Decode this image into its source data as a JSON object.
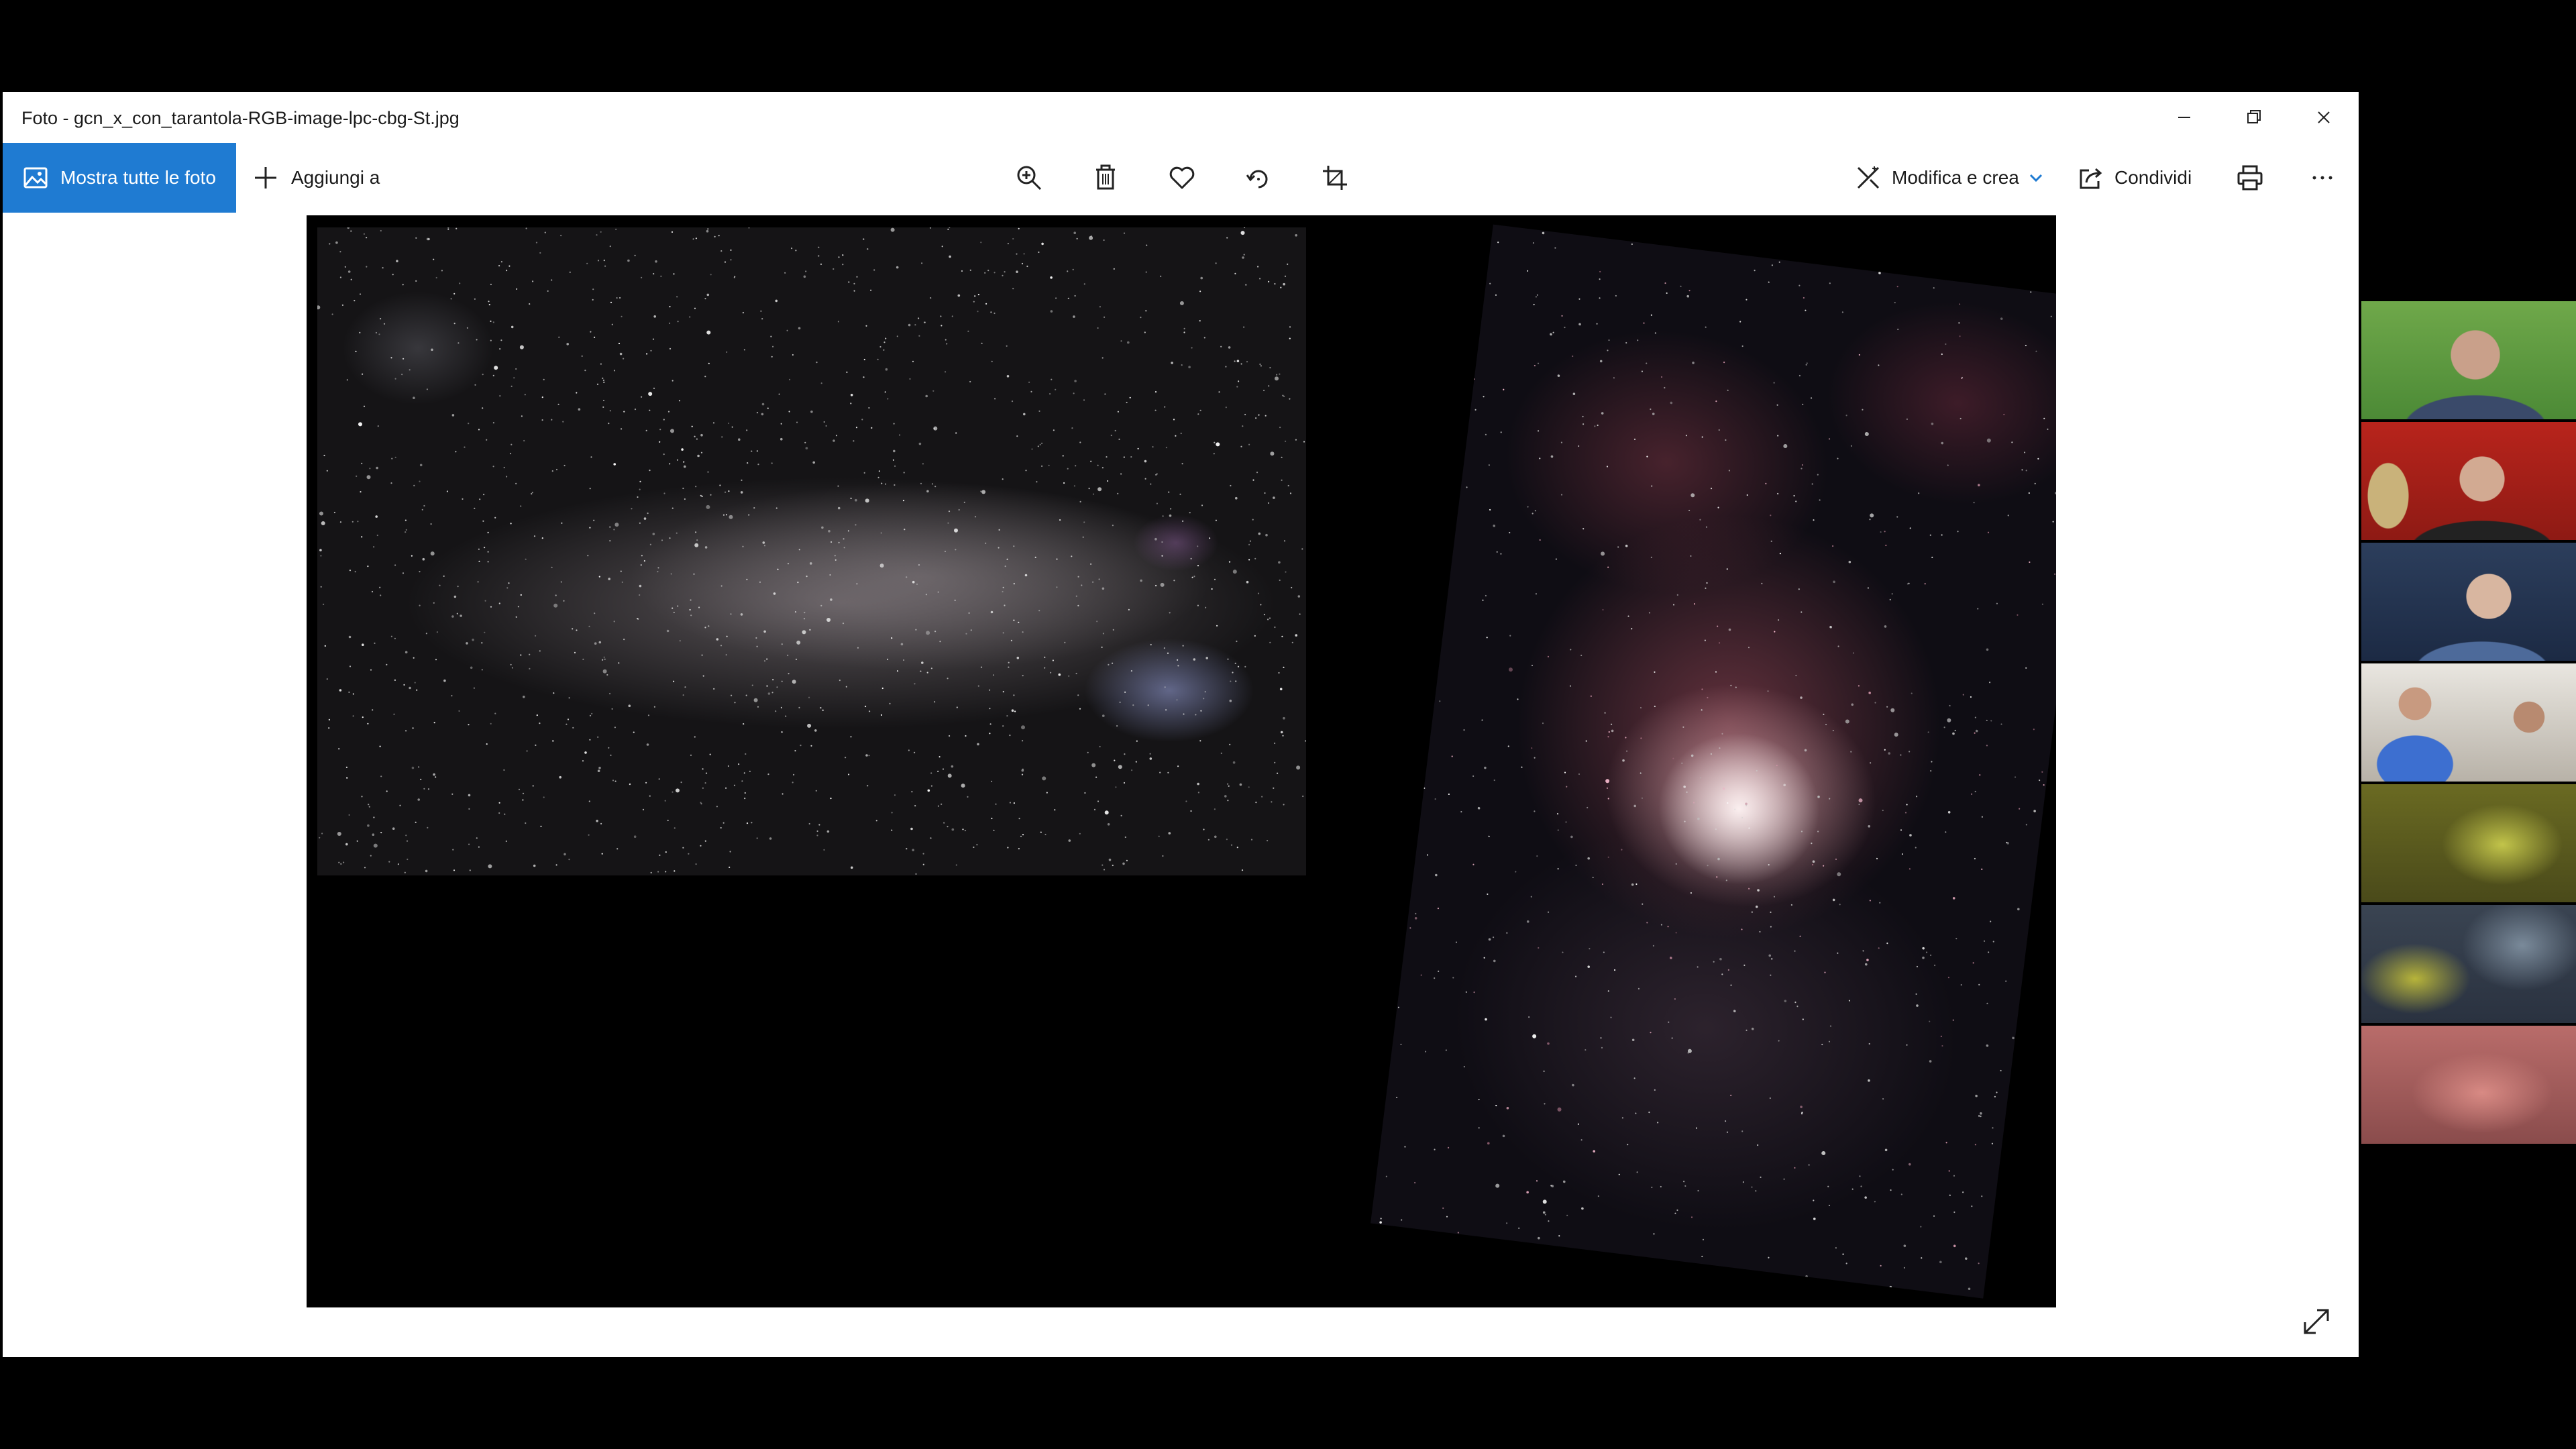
{
  "window": {
    "title": "Foto - gcn_x_con_tarantola-RGB-image-lpc-cbg-St.jpg"
  },
  "toolbar": {
    "show_all_label": "Mostra tutte le foto",
    "add_to_label": "Aggiungi a",
    "edit_create_label": "Modifica e crea",
    "share_label": "Condividi"
  },
  "icons": {
    "photos": "photos-icon",
    "add": "plus-icon",
    "zoom": "zoom-in-icon",
    "delete": "trash-icon",
    "favorite": "heart-icon",
    "rotate": "rotate-icon",
    "crop": "crop-icon",
    "edit": "edit-create-icon",
    "share": "share-icon",
    "print": "print-icon",
    "more": "more-icon",
    "expand": "expand-icon"
  },
  "colors": {
    "accent": "#1f7bd2",
    "window_bg": "#ffffff",
    "canvas_bg": "#000000"
  },
  "participants": {
    "count": 7
  }
}
